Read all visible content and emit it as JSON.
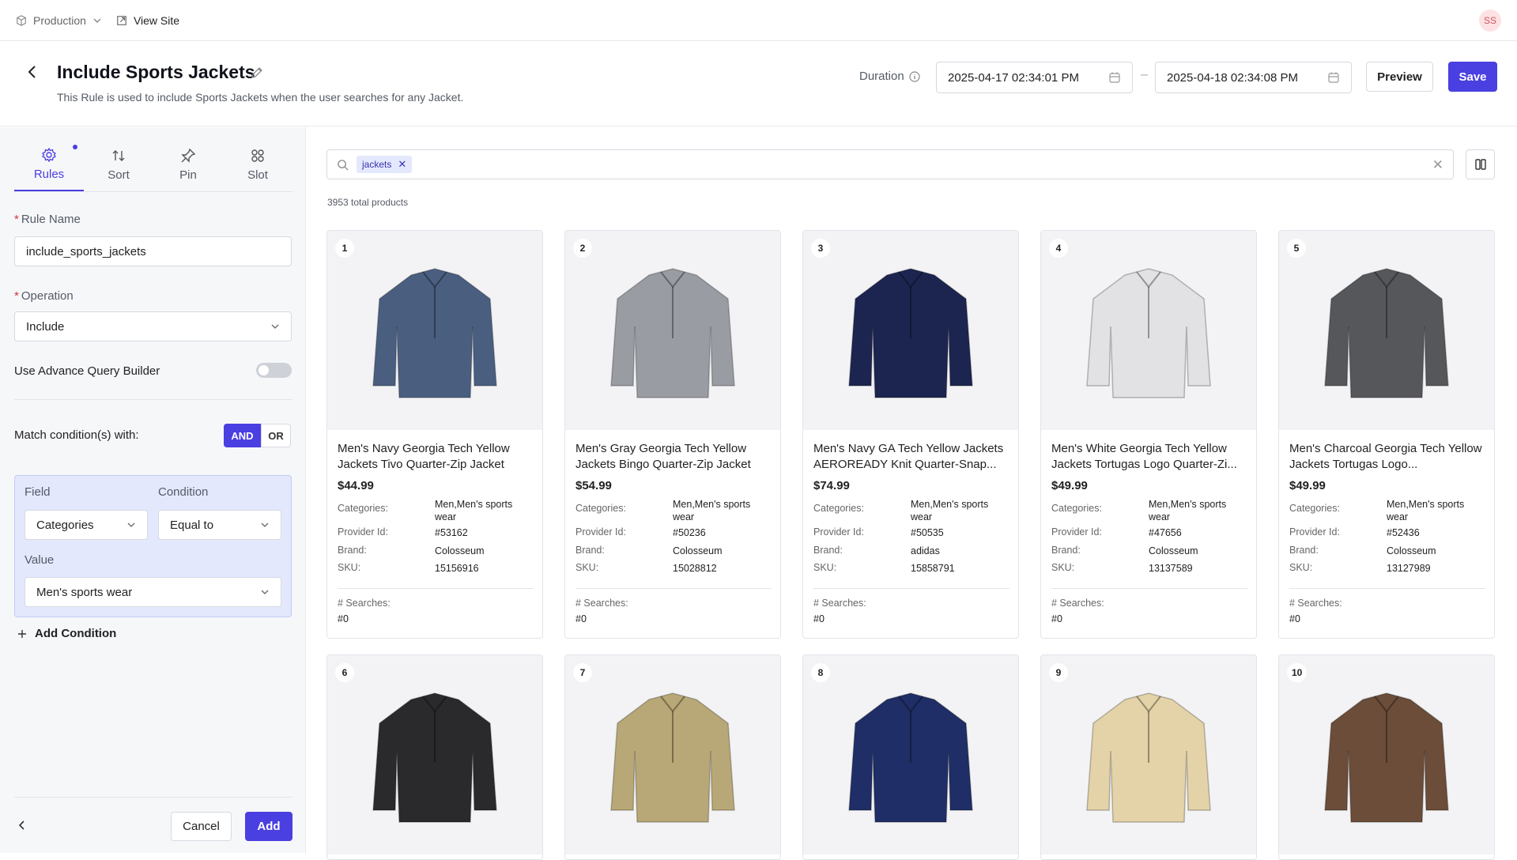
{
  "topbar": {
    "environment": "Production",
    "view_site": "View Site",
    "avatar": "SS"
  },
  "header": {
    "title": "Include Sports Jackets",
    "subtitle": "This Rule is used to include Sports Jackets when the user searches for any Jacket.",
    "duration_label": "Duration",
    "start_date": "2025-04-17 02:34:01 PM",
    "end_date": "2025-04-18 02:34:08 PM",
    "date_separator": "–",
    "preview_label": "Preview",
    "save_label": "Save"
  },
  "sidebar": {
    "tabs": [
      {
        "label": "Rules",
        "icon": "gear-icon",
        "active": true
      },
      {
        "label": "Sort",
        "icon": "sort-icon"
      },
      {
        "label": "Pin",
        "icon": "pin-icon"
      },
      {
        "label": "Slot",
        "icon": "grid-icon"
      }
    ],
    "rule_name_label": "Rule Name",
    "rule_name_value": "include_sports_jackets",
    "operation_label": "Operation",
    "operation_value": "Include",
    "advance_query_label": "Use Advance Query Builder",
    "advance_query_enabled": false,
    "match_label": "Match condition(s) with:",
    "match_and": "AND",
    "match_or": "OR",
    "condition": {
      "field_label": "Field",
      "field_value": "Categories",
      "condition_label": "Condition",
      "condition_value": "Equal to",
      "value_label": "Value",
      "value_value": "Men's sports wear"
    },
    "add_condition_label": "Add Condition",
    "cancel_label": "Cancel",
    "add_label": "Add"
  },
  "main": {
    "search_chip": "jackets",
    "total_products": "3953 total products",
    "attr_labels": {
      "categories": "Categories:",
      "provider": "Provider Id:",
      "brand": "Brand:",
      "sku": "SKU:",
      "searches": "# Searches:"
    },
    "products": [
      {
        "rank": "1",
        "name": "Men's Navy Georgia Tech Yellow Jackets Tivo Quarter-Zip Jacket",
        "price": "$44.99",
        "categories": "Men,Men's sports wear",
        "provider_id": "#53162",
        "brand": "Colosseum",
        "sku": "15156916",
        "searches": "#0",
        "color": "#4a5f80"
      },
      {
        "rank": "2",
        "name": "Men's Gray Georgia Tech Yellow Jackets Bingo Quarter-Zip Jacket",
        "price": "$54.99",
        "categories": "Men,Men's sports wear",
        "provider_id": "#50236",
        "brand": "Colosseum",
        "sku": "15028812",
        "searches": "#0",
        "color": "#9a9ca3"
      },
      {
        "rank": "3",
        "name": "Men's Navy GA Tech Yellow Jackets AEROREADY Knit Quarter-Snap...",
        "price": "$74.99",
        "categories": "Men,Men's sports wear",
        "provider_id": "#50535",
        "brand": "adidas",
        "sku": "15858791",
        "searches": "#0",
        "color": "#1c2550"
      },
      {
        "rank": "4",
        "name": "Men's White Georgia Tech Yellow Jackets Tortugas Logo Quarter-Zi...",
        "price": "$49.99",
        "categories": "Men,Men's sports wear",
        "provider_id": "#47656",
        "brand": "Colosseum",
        "sku": "13137589",
        "searches": "#0",
        "color": "#e2e2e4"
      },
      {
        "rank": "5",
        "name": "Men's Charcoal Georgia Tech Yellow Jackets Tortugas Logo...",
        "price": "$49.99",
        "categories": "Men,Men's sports wear",
        "provider_id": "#52436",
        "brand": "Colosseum",
        "sku": "13127989",
        "searches": "#0",
        "color": "#56575b"
      },
      {
        "rank": "6",
        "color": "#2a2a2c"
      },
      {
        "rank": "7",
        "color": "#b9a877"
      },
      {
        "rank": "8",
        "color": "#1f2e66"
      },
      {
        "rank": "9",
        "color": "#e4d3a8"
      },
      {
        "rank": "10",
        "color": "#6b4d3a"
      }
    ]
  }
}
